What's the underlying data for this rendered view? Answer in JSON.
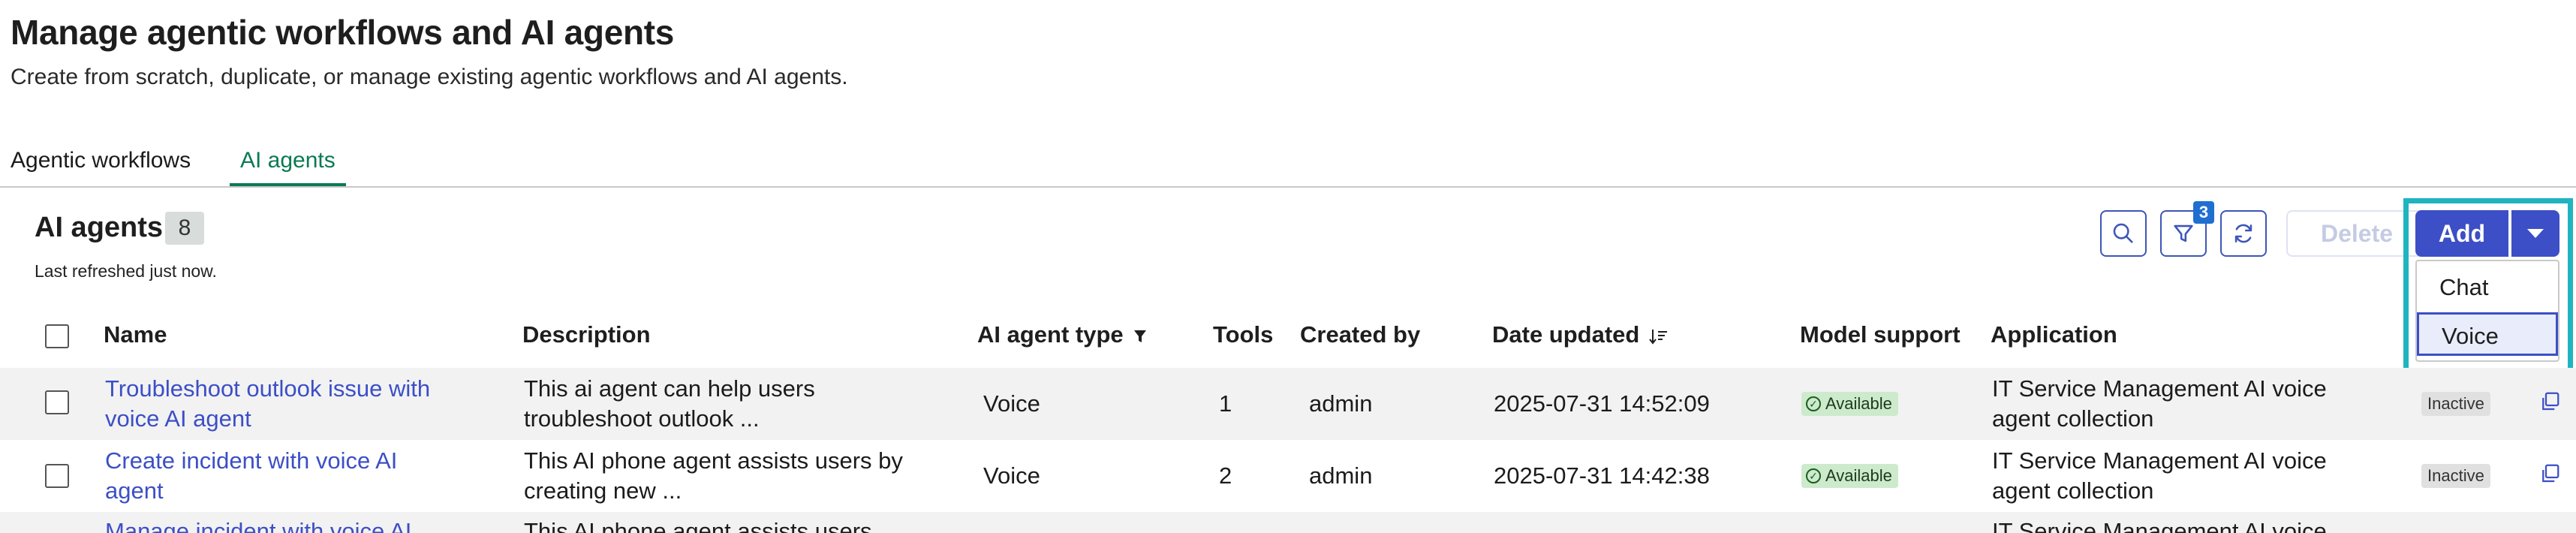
{
  "header": {
    "title": "Manage agentic workflows and AI agents",
    "subtitle": "Create from scratch, duplicate, or manage existing agentic workflows and AI agents."
  },
  "tabs": [
    {
      "label": "Agentic workflows",
      "active": false
    },
    {
      "label": "AI agents",
      "active": true
    }
  ],
  "section": {
    "title": "AI agents",
    "count": "8",
    "refreshed": "Last refreshed just now."
  },
  "toolbar": {
    "search_icon": "search-icon",
    "filter_icon": "filter-icon",
    "filter_count": "3",
    "refresh_icon": "refresh-icon",
    "delete_label": "Delete",
    "add_label": "Add",
    "add_menu": [
      "Chat",
      "Voice"
    ],
    "add_menu_selected": "Voice"
  },
  "table": {
    "columns": [
      "Name",
      "Description",
      "AI agent type",
      "Tools",
      "Created by",
      "Date updated",
      "Model support",
      "Application"
    ],
    "rows": [
      {
        "name_line1": "Troubleshoot outlook issue with",
        "name_line2": "voice AI agent",
        "desc_line1": "This ai agent can help users",
        "desc_line2": "troubleshoot outlook ...",
        "type": "Voice",
        "tools": "1",
        "created_by": "admin",
        "date_updated": "2025-07-31 14:52:09",
        "model_support": "Available",
        "app_line1": "IT Service Management AI voice",
        "app_line2": "agent collection",
        "status": "Inactive"
      },
      {
        "name_line1": "Create incident with voice AI",
        "name_line2": "agent",
        "desc_line1": "This AI phone agent assists users by",
        "desc_line2": "creating new ...",
        "type": "Voice",
        "tools": "2",
        "created_by": "admin",
        "date_updated": "2025-07-31 14:42:38",
        "model_support": "Available",
        "app_line1": "IT Service Management AI voice",
        "app_line2": "agent collection",
        "status": "Inactive"
      },
      {
        "name_line1": "Manage incident with voice AI",
        "desc_line1": "This AI phone agent assists users",
        "app_line1": "IT Service Management AI voice"
      }
    ]
  },
  "colors": {
    "accent": "#3c4fc6",
    "tab_active": "#0a7a52",
    "highlight_outline": "#1fb4c0",
    "available_bg": "#cdeacd"
  }
}
